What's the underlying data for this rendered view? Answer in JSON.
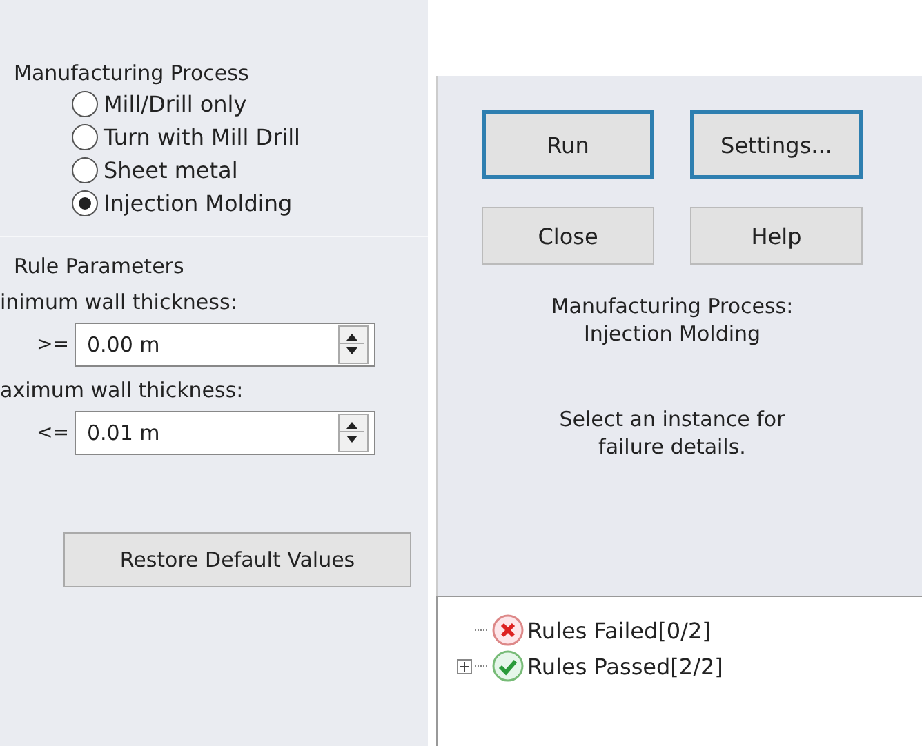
{
  "process_group": {
    "title": "Manufacturing Process",
    "options": [
      {
        "label": "Mill/Drill only",
        "selected": false
      },
      {
        "label": "Turn with Mill Drill",
        "selected": false
      },
      {
        "label": "Sheet metal",
        "selected": false
      },
      {
        "label": "Injection Molding",
        "selected": true
      }
    ]
  },
  "rule_parameters": {
    "title": "Rule Parameters",
    "fields": [
      {
        "label": "inimum wall thickness:",
        "operator": ">=",
        "value": "0.00 m"
      },
      {
        "label": "aximum wall thickness:",
        "operator": "<=",
        "value": "0.01 m"
      }
    ]
  },
  "restore_button": "Restore Default Values",
  "buttons": [
    {
      "label": "Run",
      "highlighted": true
    },
    {
      "label": "Settings...",
      "highlighted": true
    },
    {
      "label": "Close",
      "highlighted": false
    },
    {
      "label": "Help",
      "highlighted": false
    }
  ],
  "process_info": [
    "Manufacturing Process:",
    "Injection Molding"
  ],
  "hint": [
    "Select an instance for",
    "failure details."
  ],
  "tree": [
    {
      "label": "Rules Failed[0/2]",
      "kind": "failed"
    },
    {
      "label": "Rules Passed[2/2]",
      "kind": "passed",
      "expanded": false
    }
  ]
}
